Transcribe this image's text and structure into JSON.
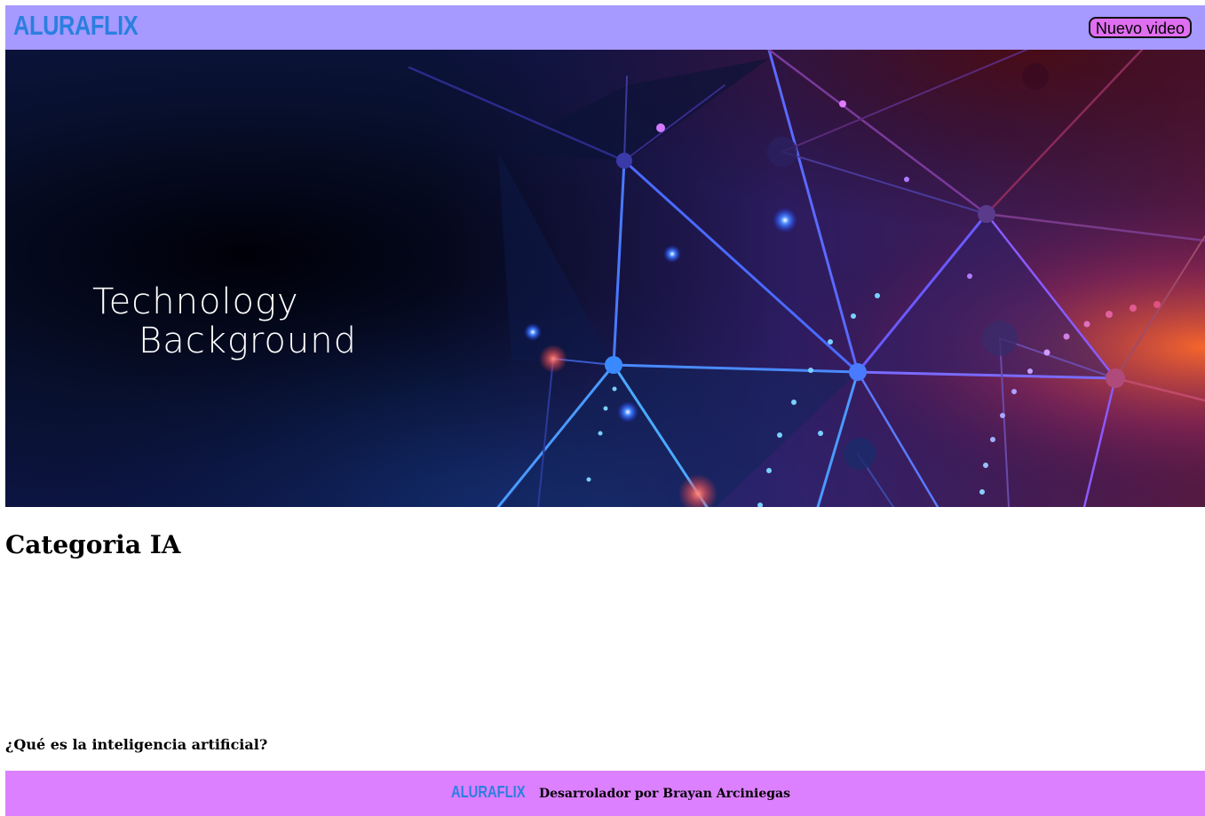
{
  "header": {
    "logo_text": "ALURAFLIX",
    "new_video_label": "Nuevo video"
  },
  "banner": {
    "title_line1": "Technology",
    "title_line2": "Background"
  },
  "category": {
    "title": "Categoria IA",
    "video_title": "¿Qué es la inteligencia artificial?"
  },
  "footer": {
    "logo_text": "ALURAFLIX",
    "credit": "Desarrolador por Brayan Arciniegas"
  },
  "colors": {
    "header_bg": "#a699ff",
    "footer_bg": "#dc80ff",
    "logo": "#2a7fe0",
    "button_bg": "#e06ef0"
  }
}
